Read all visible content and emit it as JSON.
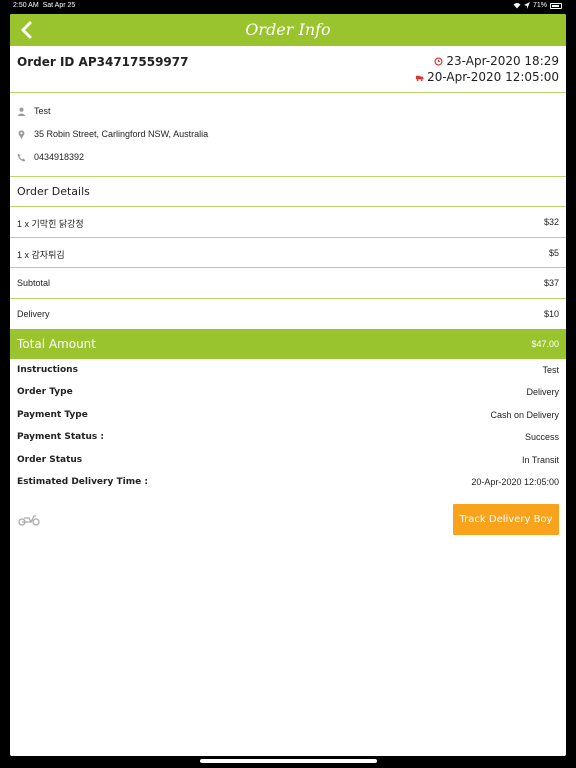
{
  "status_bar": {
    "time": "2:50 AM",
    "date": "Sat Apr 25",
    "battery": "71%"
  },
  "header": {
    "title": "Order Info",
    "back_icon": "chevron-left-icon"
  },
  "order": {
    "id_label": "Order ID AP34717559977",
    "ordered_at": "23-Apr-2020 18:29",
    "delivery_at": "20-Apr-2020 12:05:00"
  },
  "contact": {
    "name": "Test",
    "address": "35 Robin Street, Carlingford NSW, Australia",
    "phone": "0434918392"
  },
  "order_details": {
    "title": "Order Details",
    "items": [
      {
        "label": "1 x 기막힌 닭강정",
        "price": "$32"
      },
      {
        "label": "1 x 감자튀김",
        "price": "$5"
      }
    ],
    "subtotal_label": "Subtotal",
    "subtotal": "$37",
    "delivery_label": "Delivery",
    "delivery": "$10"
  },
  "total": {
    "label": "Total Amount",
    "value": "$47.00"
  },
  "info": [
    {
      "key": "Instructions",
      "value": "Test"
    },
    {
      "key": "Order Type",
      "value": "Delivery"
    },
    {
      "key": "Payment Type",
      "value": "Cash on Delivery"
    },
    {
      "key": "Payment Status :",
      "value": "Success"
    },
    {
      "key": "Order Status",
      "value": "In Transit"
    },
    {
      "key": "Estimated Delivery Time :",
      "value": "20-Apr-2020 12:05:00"
    }
  ],
  "track_button": {
    "label": "Track Delivery Boy"
  },
  "colors": {
    "accent": "#9ac42e",
    "button": "#f9a21b",
    "divider": "#b8d86a"
  }
}
